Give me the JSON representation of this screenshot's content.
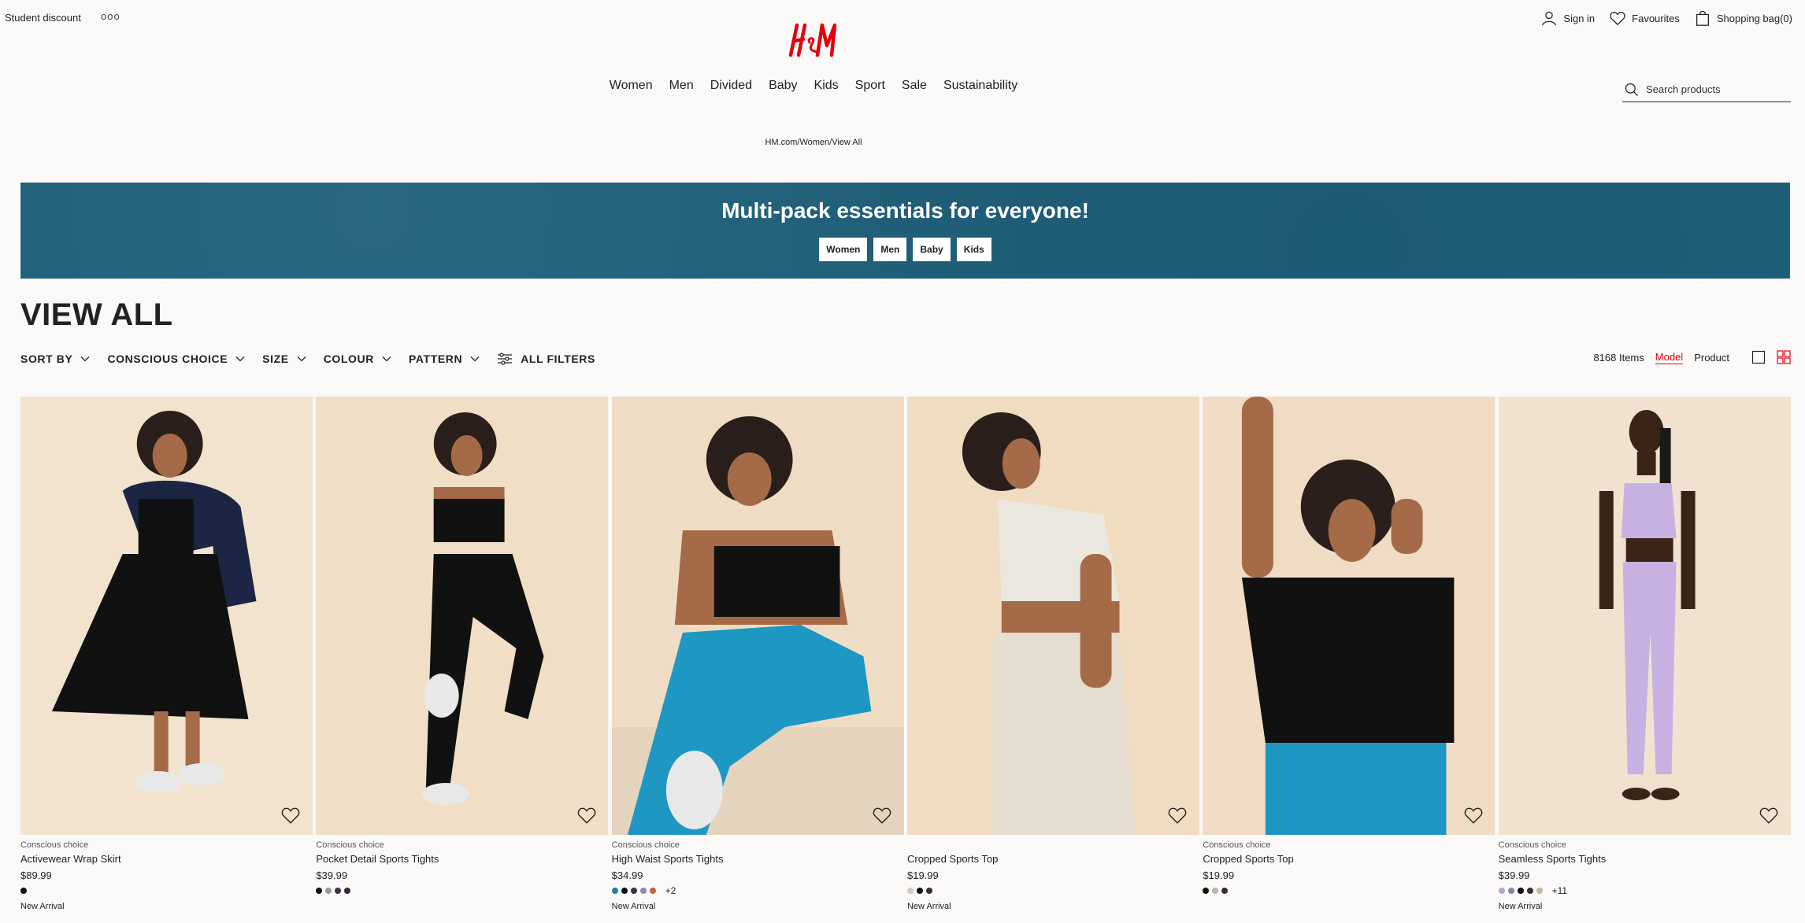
{
  "header": {
    "student_discount": "Student discount",
    "more": "ooo",
    "brand_color": "#e50010",
    "actions": {
      "sign_in": "Sign in",
      "favourites": "Favourites",
      "shopping_bag": "Shopping bag(0)"
    },
    "nav": [
      "Women",
      "Men",
      "Divided",
      "Baby",
      "Kids",
      "Sport",
      "Sale",
      "Sustainability"
    ],
    "search_placeholder": "Search products"
  },
  "breadcrumb": "HM.com/Women/View All",
  "banner": {
    "title": "Multi-pack essentials for everyone!",
    "buttons": [
      "Women",
      "Men",
      "Baby",
      "Kids"
    ],
    "color": "#215f79"
  },
  "page_title": "VIEW ALL",
  "filters": {
    "items": [
      "SORT BY",
      "CONSCIOUS CHOICE",
      "SIZE",
      "COLOUR",
      "PATTERN"
    ],
    "all_filters": "ALL FILTERS",
    "item_count": "8168 Items",
    "view_model": "Model",
    "view_product": "Product"
  },
  "products": [
    {
      "tag_top": "Conscious choice",
      "name": "Activewear Wrap Skirt",
      "price": "$89.99",
      "swatches": [
        "#111111"
      ],
      "more": "",
      "badge": "New Arrival"
    },
    {
      "tag_top": "Conscious choice",
      "name": "Pocket Detail Sports Tights",
      "price": "$39.99",
      "swatches": [
        "#111111",
        "#9a9a9a",
        "#3a3550",
        "#3c2636"
      ],
      "more": "",
      "badge": ""
    },
    {
      "tag_top": "Conscious choice",
      "name": "High Waist Sports Tights",
      "price": "$34.99",
      "swatches": [
        "#1f7fa3",
        "#111111",
        "#2f3550",
        "#8a8ab0",
        "#c0653a"
      ],
      "more": "+2",
      "badge": "New Arrival"
    },
    {
      "tag_top": "",
      "name": "Cropped Sports Top",
      "price": "$19.99",
      "swatches": [
        "#cfc9c0",
        "#111111",
        "#3a2a36"
      ],
      "more": "",
      "badge": "New Arrival"
    },
    {
      "tag_top": "Conscious choice",
      "name": "Cropped Sports Top",
      "price": "$19.99",
      "swatches": [
        "#111111",
        "#b9b4ad",
        "#3a2a36"
      ],
      "more": "",
      "badge": ""
    },
    {
      "tag_top": "Conscious choice",
      "name": "Seamless Sports Tights",
      "price": "$39.99",
      "swatches": [
        "#b9a2dc",
        "#8686a8",
        "#111111",
        "#3a2a36",
        "#c8b59a"
      ],
      "more": "+11",
      "badge": "New Arrival"
    }
  ]
}
